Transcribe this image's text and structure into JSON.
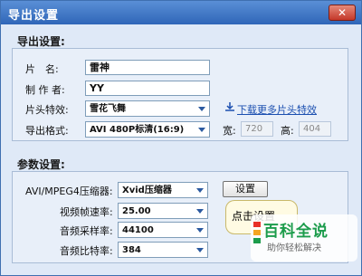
{
  "window": {
    "title": "导出设置",
    "close_label": "✕"
  },
  "export_group": {
    "title": "导出设置:",
    "name_label": "片　名:",
    "name_value": "雷神",
    "author_label": "制 作 者:",
    "author_value": "YY",
    "effect_label": "片头特效:",
    "effect_value": "雪花飞舞",
    "download_link": "下载更多片头特效",
    "format_label": "导出格式:",
    "format_value": "AVI 480P标清(16:9)",
    "width_label": "宽:",
    "width_value": "720",
    "height_label": "高:",
    "height_value": "404"
  },
  "param_group": {
    "title": "参数设置:",
    "codec_label": "AVI/MPEG4压缩器:",
    "codec_value": "Xvid压缩器",
    "settings_button": "设置",
    "framerate_label": "视频帧速率:",
    "framerate_value": "25.00",
    "samplerate_label": "音频采样率:",
    "samplerate_value": "44100",
    "bitrate_label": "音频比特率:",
    "bitrate_value": "384"
  },
  "tooltip": {
    "text": "点击设置"
  },
  "watermark": {
    "brand": "百科全说",
    "slogan": "助你轻松解决"
  },
  "colors": {
    "titlebar": "#2f66b8",
    "link": "#1b4fb0",
    "brand": "#1c9c4c"
  }
}
